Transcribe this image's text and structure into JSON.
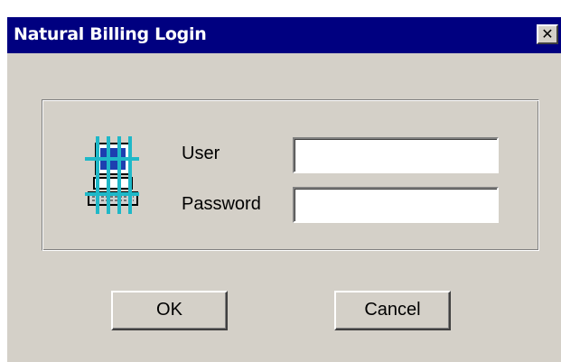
{
  "window": {
    "title": "Natural Billing Login",
    "close_label": "✕",
    "close_icon": "close-icon"
  },
  "form": {
    "icon": "computer-grid-icon",
    "user_label": "User",
    "user_value": "",
    "password_label": "Password",
    "password_value": ""
  },
  "buttons": {
    "ok_label": "OK",
    "cancel_label": "Cancel"
  },
  "colors": {
    "titlebar": "#000080",
    "window_face": "#d4d0c8",
    "icon_accent": "#1fb8c8"
  }
}
